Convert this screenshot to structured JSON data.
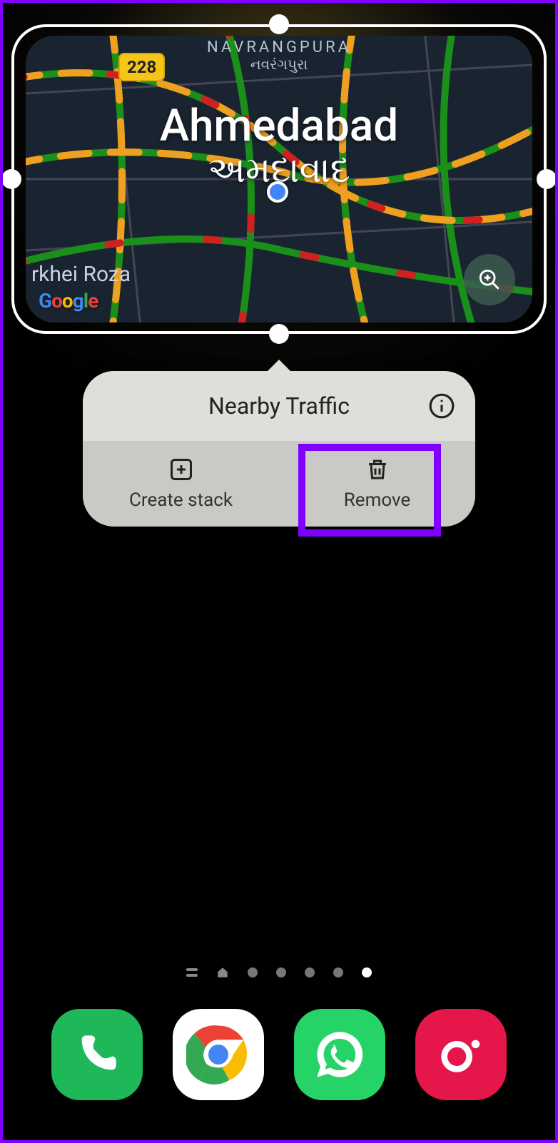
{
  "widget": {
    "city_en": "Ahmedabad",
    "city_gu": "અમદાવાદ",
    "area_en": "NAVRANGPURA",
    "area_gu": "નવરંગપુરા",
    "route_number": "228",
    "poi": "rkhei Roza",
    "attribution": "Google"
  },
  "popup": {
    "title": "Nearby Traffic",
    "actions": {
      "create_stack": "Create stack",
      "remove": "Remove"
    }
  },
  "pager": {
    "total": 7,
    "active_index": 6
  },
  "dock": {
    "apps": [
      "phone",
      "chrome",
      "whatsapp",
      "camera"
    ]
  },
  "annotation": {
    "highlight_target": "remove-button",
    "highlight_color": "#8000ff"
  }
}
